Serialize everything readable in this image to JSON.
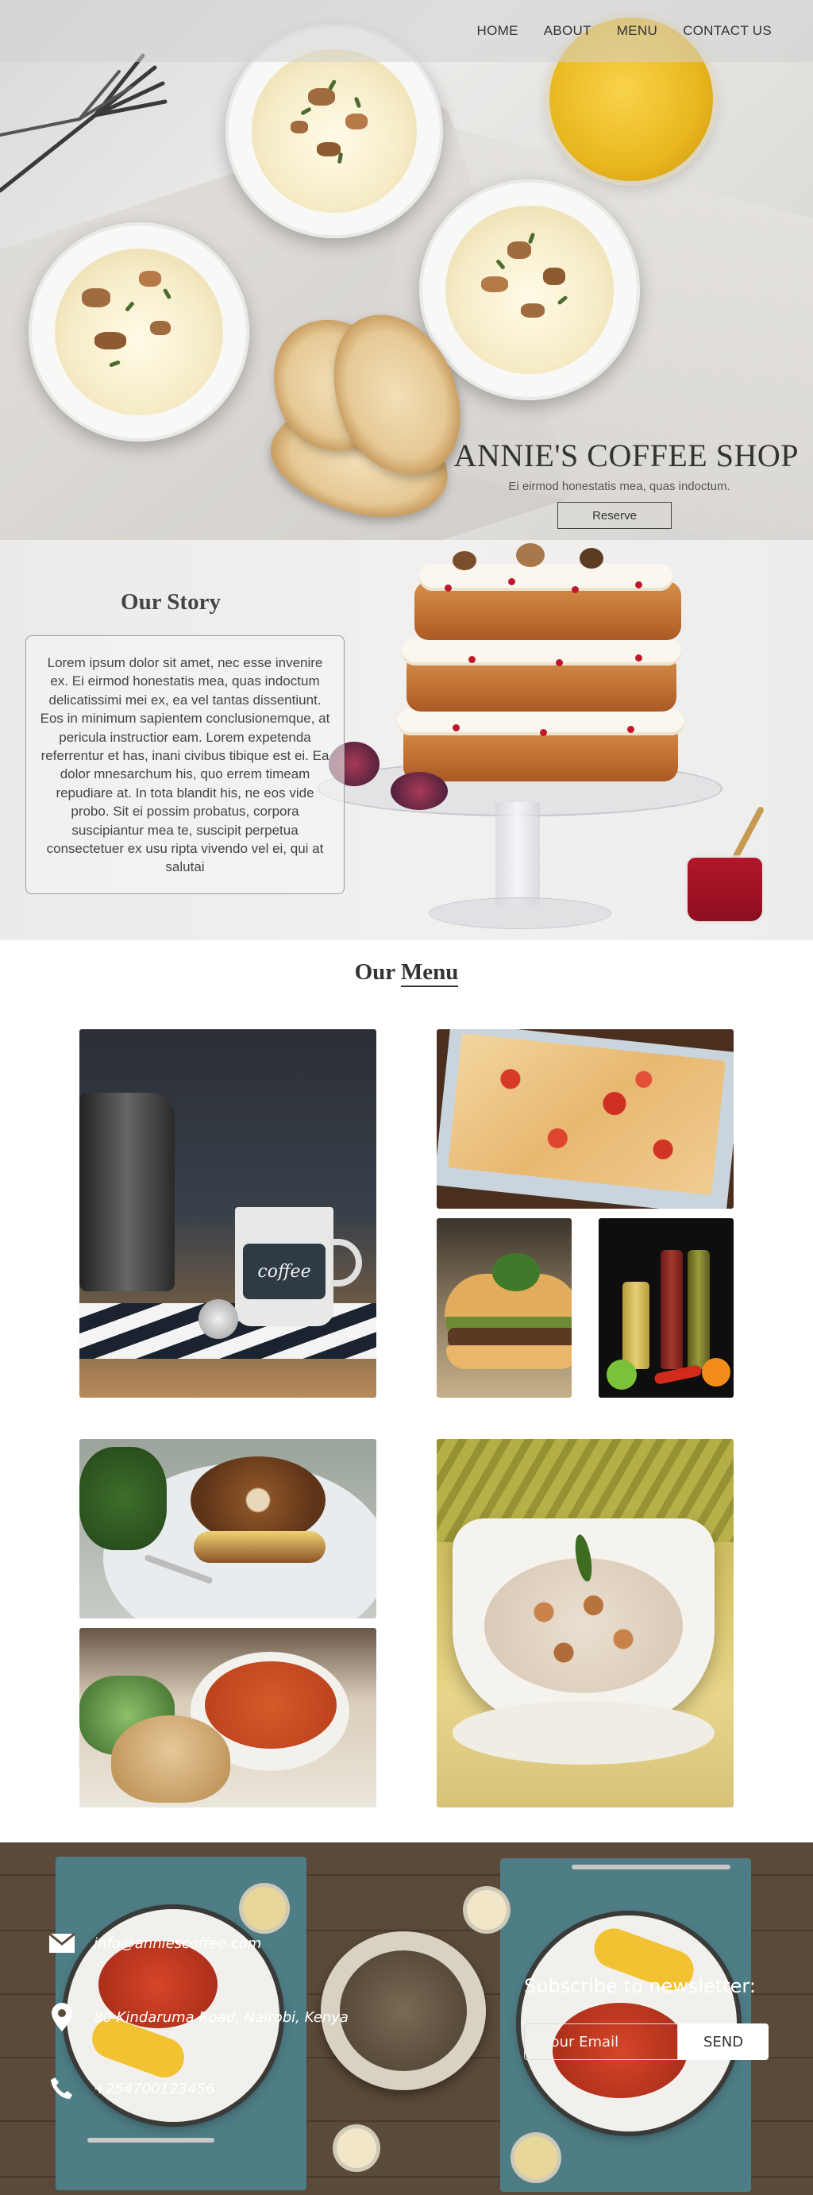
{
  "nav": {
    "items": [
      "HOME",
      "ABOUT",
      "MENU",
      "CONTACT US"
    ]
  },
  "hero": {
    "title": "ANNIE'S COFFEE SHOP",
    "subtitle": "Ei eirmod honestatis mea, quas indoctum.",
    "button_label": "Reserve"
  },
  "story": {
    "title": "Our Story",
    "body": "Lorem ipsum dolor sit amet, nec esse invenire ex. Ei eirmod honestatis mea, quas indoctum delicatissimi mei ex, ea vel tantas dissentiunt. Eos in minimum sapientem conclusionemque, at pericula instructior eam. Lorem expetenda referrentur et has, inani civibus tibique est ei. Ea dolor mnesarchum his, quo errem timeam repudiare at. In tota blandit his, ne eos vide probo. Sit ei possim probatus, corpora suscipiantur mea te, suscipit perpetua consectetuer ex usu ripta vivendo vel ei, qui at salutai"
  },
  "menu": {
    "title_prefix": "Our ",
    "title_underlined": "Menu",
    "coffee_mug_text": "coffee"
  },
  "footer": {
    "email": "info@anniescoffee.com",
    "address": "80 Kindaruma Road, Nairobi, Kenya",
    "phone": "+254700123456",
    "newsletter_title": "Subscribe to newsletter:",
    "email_placeholder": "Your Email",
    "send_label": "SEND"
  },
  "colors": {
    "footer_wood": "#5b4a39",
    "mat_teal": "#4e7d86",
    "text_dark": "#333333"
  }
}
